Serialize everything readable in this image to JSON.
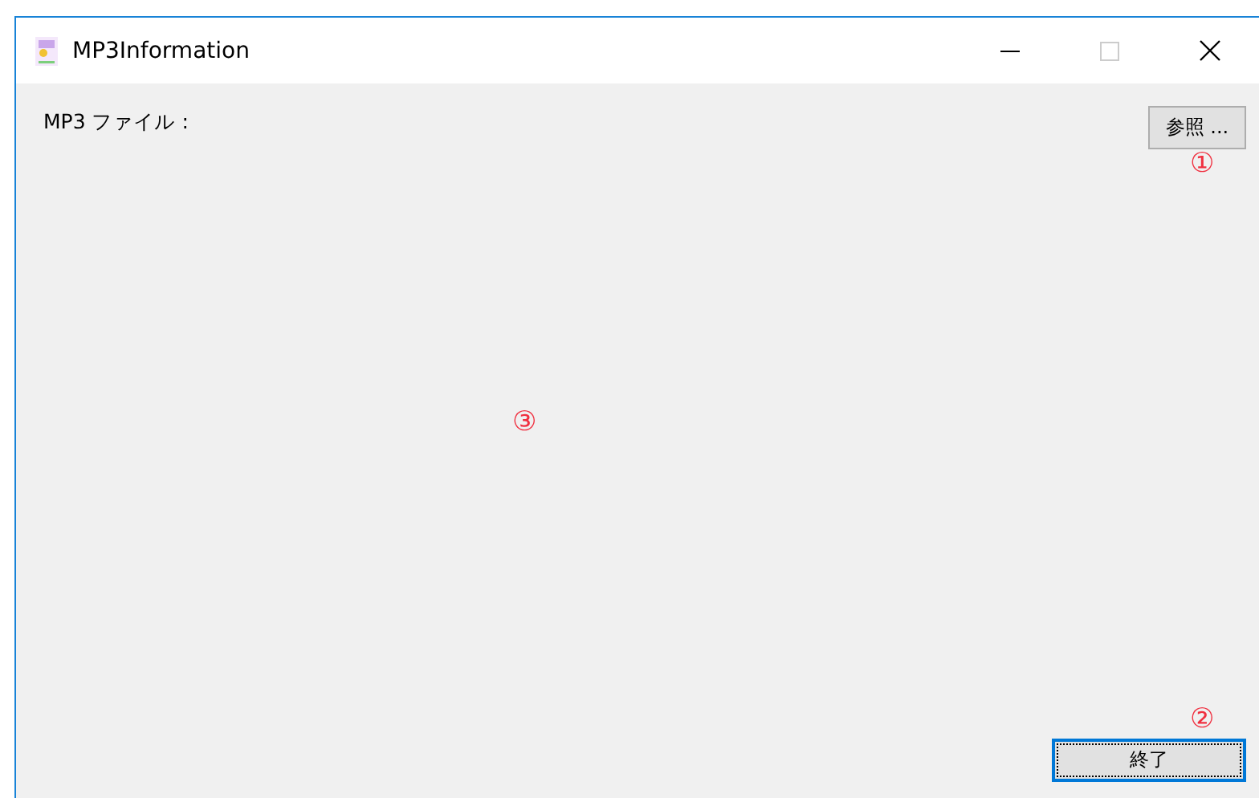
{
  "window": {
    "title": "MP3Information"
  },
  "file_label": "MP3 ファイル :",
  "browse_button": "参照 ...",
  "exit_button": {
    "label": "終了",
    "focused": true
  },
  "annotations": [
    "①",
    "②",
    "③"
  ]
}
